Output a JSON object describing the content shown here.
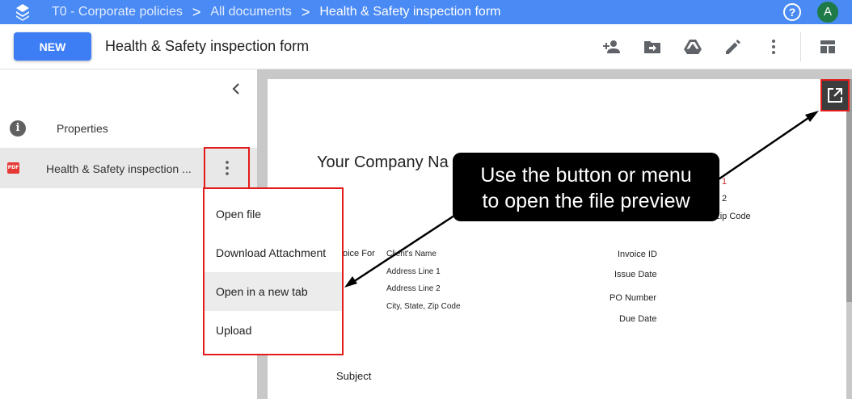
{
  "topbar": {
    "breadcrumbs": [
      "T0 - Corporate policies",
      "All documents",
      "Health & Safety inspection form"
    ],
    "separator": ">",
    "help_label": "?",
    "avatar_initial": "A"
  },
  "toolbar": {
    "new_label": "NEW",
    "title": "Health & Safety inspection form",
    "icons": [
      "add-person-icon",
      "move-to-folder-icon",
      "drive-icon",
      "edit-pencil-icon",
      "more-vert-icon",
      "layout-icon"
    ]
  },
  "sidebar": {
    "properties_label": "Properties",
    "file_badge": "PDF",
    "file_name": "Health & Safety inspection ..."
  },
  "menu": {
    "items": [
      "Open file",
      "Download Attachment",
      "Open in a new tab",
      "Upload"
    ]
  },
  "preview": {
    "company": "Your Company Na",
    "right_frag_1": "1",
    "right_frag_2": "2",
    "right_frag_3": "Zip Code",
    "invoice_for": "oice For",
    "client_name": "Client's Name",
    "address_1": "Address Line 1",
    "address_2": "Address Line 2",
    "city": "City, State, Zip Code",
    "invoice_id": "Invoice ID",
    "issue_date": "Issue Date",
    "po_number": "PO Number",
    "due_date": "Due Date",
    "subject": "Subject"
  },
  "annotation": {
    "line1": "Use the button or menu",
    "line2": "to open the file preview"
  },
  "colors": {
    "topbar": "#4a8af4",
    "new_button": "#3d7ef5",
    "highlight": "#e41b1b",
    "avatar": "#1e7a46"
  }
}
